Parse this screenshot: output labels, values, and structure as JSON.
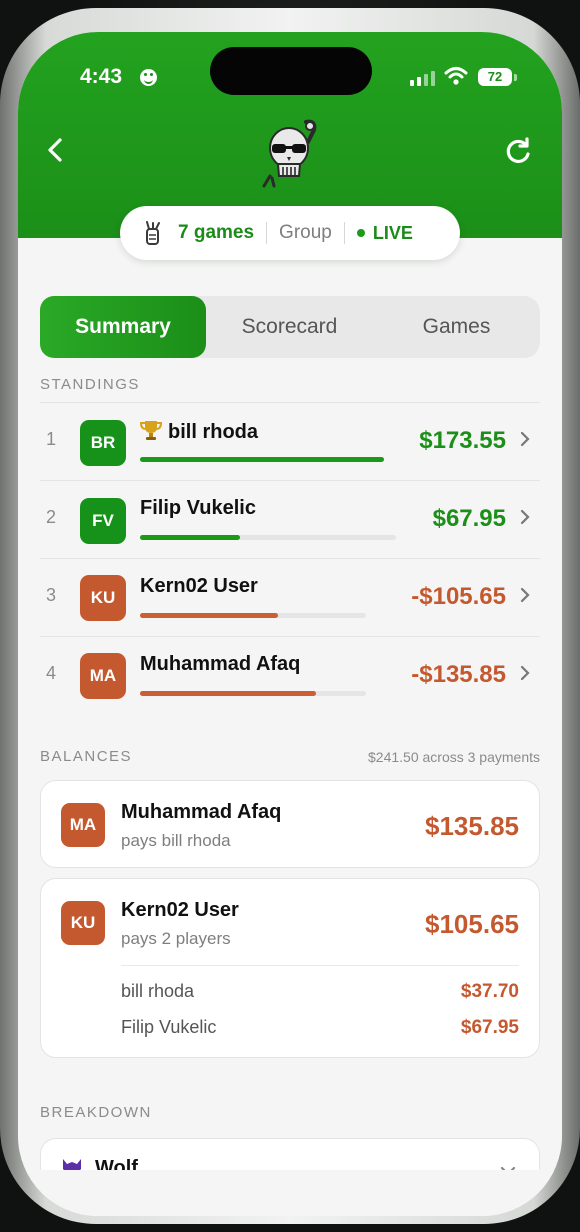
{
  "status": {
    "time": "4:43",
    "battery": "72"
  },
  "header": {
    "logo_icon": "skull-logo-icon",
    "back_icon": "chevron-left-icon",
    "refresh_icon": "refresh-icon"
  },
  "info": {
    "games": "7 games",
    "mode": "Group",
    "live": "LIVE"
  },
  "tabs": [
    {
      "label": "Summary",
      "active": true
    },
    {
      "label": "Scorecard",
      "active": false
    },
    {
      "label": "Games",
      "active": false
    }
  ],
  "standings": {
    "heading": "STANDINGS",
    "rows": [
      {
        "rank": "1",
        "initials": "BR",
        "name": "bill rhoda",
        "leader": true,
        "amount": "$173.55",
        "positive": true,
        "bar_fraction": 1.0
      },
      {
        "rank": "2",
        "initials": "FV",
        "name": "Filip Vukelic",
        "leader": false,
        "amount": "$67.95",
        "positive": true,
        "bar_fraction": 0.39
      },
      {
        "rank": "3",
        "initials": "KU",
        "name": "Kern02 User",
        "leader": false,
        "amount": "-$105.65",
        "positive": false,
        "bar_fraction": 0.61
      },
      {
        "rank": "4",
        "initials": "MA",
        "name": "Muhammad Afaq",
        "leader": false,
        "amount": "-$135.85",
        "positive": false,
        "bar_fraction": 0.78
      }
    ]
  },
  "balances": {
    "heading": "BALANCES",
    "summary": "$241.50 across 3 payments",
    "cards": [
      {
        "initials": "MA",
        "name": "Muhammad Afaq",
        "subtitle": "pays bill rhoda",
        "amount": "$135.85"
      },
      {
        "initials": "KU",
        "name": "Kern02 User",
        "subtitle": "pays 2 players",
        "amount": "$105.65",
        "details": [
          {
            "name": "bill rhoda",
            "amount": "$37.70"
          },
          {
            "name": "Filip Vukelic",
            "amount": "$67.95"
          }
        ]
      }
    ]
  },
  "breakdown": {
    "heading": "BREAKDOWN",
    "first_item": "Wolf"
  },
  "colors": {
    "green": "#1b8f18",
    "negative": "#c4592f",
    "avatar_green": "#16921a",
    "avatar_orange": "#c4592f"
  }
}
